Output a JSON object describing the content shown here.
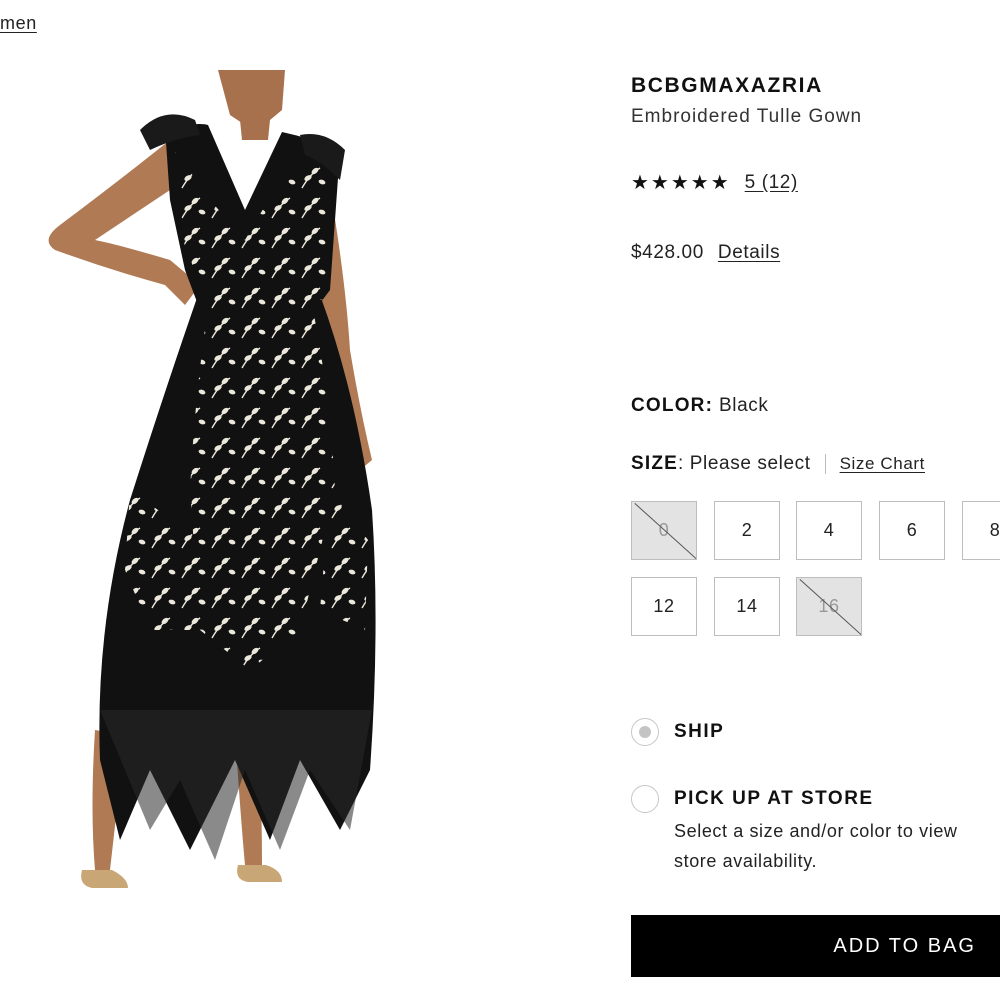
{
  "breadcrumb": {
    "label": "men"
  },
  "product": {
    "brand": "BCBGMAXAZRIA",
    "name": "Embroidered Tulle Gown",
    "rating_stars": "★★★★★",
    "rating_text": "5 (12)",
    "price": "$428.00",
    "details_label": "Details",
    "image_icon": "dress-photo"
  },
  "color": {
    "label": "COLOR:",
    "value": "Black"
  },
  "size": {
    "label": "SIZE",
    "value": ": Please select",
    "chart_label": "Size Chart",
    "options": [
      {
        "label": "0",
        "available": false
      },
      {
        "label": "2",
        "available": true
      },
      {
        "label": "4",
        "available": true
      },
      {
        "label": "6",
        "available": true
      },
      {
        "label": "8",
        "available": true
      },
      {
        "label": "12",
        "available": true
      },
      {
        "label": "14",
        "available": true
      },
      {
        "label": "16",
        "available": false
      }
    ]
  },
  "fulfillment": {
    "ship_label": "SHIP",
    "pickup_label": "PICK UP AT STORE",
    "pickup_note": "Select a size and/or color to view store availability."
  },
  "cart": {
    "add_label": "ADD TO BAG"
  },
  "colors": {
    "dress": "#111111",
    "embroidery": "#ece8dc",
    "skin": "#b07a55",
    "button": "#000000"
  }
}
